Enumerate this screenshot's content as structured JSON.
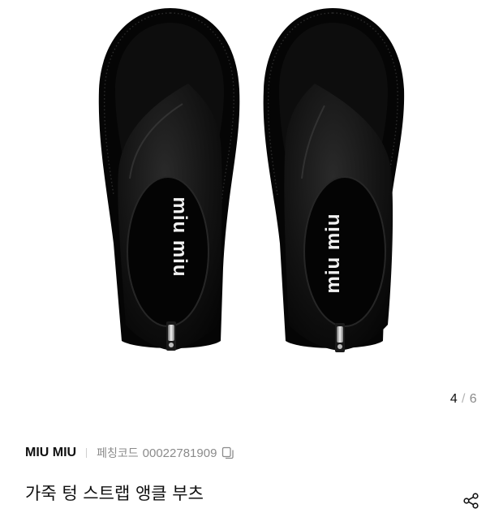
{
  "gallery": {
    "image_alt": "MIU MIU 가죽 텅 스트랩 앵클 부츠",
    "insole_logo_text": "miu miu",
    "counter": {
      "current": "4",
      "separator": "/",
      "total": "6"
    }
  },
  "product": {
    "brand": "MIU MIU",
    "code_label": "페칭코드",
    "code_value": "00022781909",
    "title": "가죽 텅 스트랩 앵클 부츠"
  },
  "icons": {
    "copy": "copy-icon",
    "share": "share-icon"
  },
  "colors": {
    "text_primary": "#111111",
    "text_secondary": "#8b8b8b",
    "shoe": "#0b0b0b"
  }
}
